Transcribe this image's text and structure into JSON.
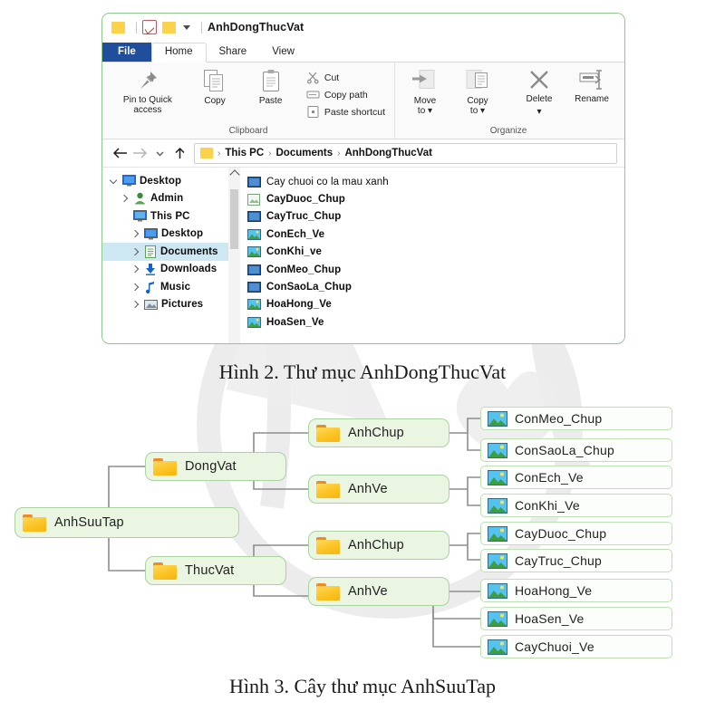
{
  "explorer": {
    "quick_access": {
      "title": "AnhDongThucVat",
      "icons": [
        "folder-icon",
        "properties-icon",
        "new-folder-icon",
        "customize-chevron-icon"
      ]
    },
    "tabs": [
      {
        "label": "File",
        "active": false,
        "kind": "file"
      },
      {
        "label": "Home",
        "active": true,
        "kind": "normal"
      },
      {
        "label": "Share",
        "active": false,
        "kind": "normal"
      },
      {
        "label": "View",
        "active": false,
        "kind": "normal"
      }
    ],
    "ribbon": {
      "groups": [
        {
          "name": "Clipboard",
          "label": "Clipboard",
          "big_buttons": [
            {
              "label": "Pin to Quick\naccess",
              "icon": "pin-icon"
            },
            {
              "label": "Copy",
              "icon": "copy-icon"
            },
            {
              "label": "Paste",
              "icon": "paste-icon"
            }
          ],
          "small_buttons": [
            {
              "label": "Cut",
              "icon": "scissors-icon"
            },
            {
              "label": "Copy path",
              "icon": "copy-path-icon"
            },
            {
              "label": "Paste shortcut",
              "icon": "paste-shortcut-icon"
            }
          ]
        },
        {
          "name": "Organize",
          "label": "Organize",
          "big_buttons": [
            {
              "label": "Move\nto",
              "icon": "move-to-icon"
            },
            {
              "label": "Copy\nto",
              "icon": "copy-to-icon"
            },
            {
              "label": "Delete",
              "icon": "delete-x-icon"
            },
            {
              "label": "Rename",
              "icon": "rename-icon"
            }
          ],
          "small_buttons": []
        }
      ]
    },
    "address_bar": {
      "back_icon": "back-arrow-icon",
      "forward_icon": "forward-arrow-icon",
      "recent_icon": "chevron-down-icon",
      "up_icon": "up-arrow-icon",
      "breadcrumbs": [
        "This PC",
        "Documents",
        "AnhDongThucVat"
      ],
      "separator": "›"
    },
    "nav_pane": {
      "items": [
        {
          "label": "Desktop",
          "indent": 0,
          "twisty": "down",
          "icon": "monitor-icon",
          "selected": false
        },
        {
          "label": "Admin",
          "indent": 1,
          "twisty": "right",
          "icon": "user-icon",
          "selected": false
        },
        {
          "label": "This PC",
          "indent": 1,
          "twisty": "none",
          "icon": "monitor-icon",
          "selected": false
        },
        {
          "label": "Desktop",
          "indent": 2,
          "twisty": "right",
          "icon": "monitor-icon",
          "selected": false
        },
        {
          "label": "Documents",
          "indent": 2,
          "twisty": "right",
          "icon": "documents-icon",
          "selected": true
        },
        {
          "label": "Downloads",
          "indent": 2,
          "twisty": "right",
          "icon": "download-icon",
          "selected": false
        },
        {
          "label": "Music",
          "indent": 2,
          "twisty": "right",
          "icon": "music-note-icon",
          "selected": false
        },
        {
          "label": "Pictures",
          "indent": 2,
          "twisty": "right",
          "icon": "pictures-icon",
          "selected": false
        }
      ]
    },
    "file_list": {
      "items": [
        {
          "label": "Cay chuoi co la mau xanh",
          "icon": "bmp-image-icon",
          "bold": false
        },
        {
          "label": "CayDuoc_Chup",
          "icon": "gif-image-icon",
          "bold": true
        },
        {
          "label": "CayTruc_Chup",
          "icon": "bmp-image-icon",
          "bold": true
        },
        {
          "label": "ConEch_Ve",
          "icon": "png-image-icon",
          "bold": true
        },
        {
          "label": "ConKhi_ve",
          "icon": "png-image-icon",
          "bold": true
        },
        {
          "label": "ConMeo_Chup",
          "icon": "bmp-image-icon",
          "bold": true
        },
        {
          "label": "ConSaoLa_Chup",
          "icon": "bmp-image-icon",
          "bold": true
        },
        {
          "label": "HoaHong_Ve",
          "icon": "png-image-icon",
          "bold": true
        },
        {
          "label": "HoaSen_Ve",
          "icon": "png-image-icon",
          "bold": true
        }
      ]
    }
  },
  "captions": {
    "figure2": "Hình 2. Thư mục AnhDongThucVat",
    "figure3": "Hình 3. Cây thư mục AnhSuuTap"
  },
  "tree": {
    "root": {
      "label": "AnhSuuTap",
      "icon": "folder-icon"
    },
    "nodes": [
      {
        "id": "root",
        "label": "AnhSuuTap",
        "icon": "folder-icon",
        "level": 0
      },
      {
        "id": "dongvat",
        "label": "DongVat",
        "icon": "folder-icon",
        "level": 1
      },
      {
        "id": "thucvat",
        "label": "ThucVat",
        "icon": "folder-icon",
        "level": 1
      },
      {
        "id": "dv-chup",
        "label": "AnhChup",
        "icon": "folder-icon",
        "level": 2
      },
      {
        "id": "dv-ve",
        "label": "AnhVe",
        "icon": "folder-icon",
        "level": 2
      },
      {
        "id": "tv-chup",
        "label": "AnhChup",
        "icon": "folder-icon",
        "level": 2
      },
      {
        "id": "tv-ve",
        "label": "AnhVe",
        "icon": "folder-icon",
        "level": 2
      }
    ],
    "leaves": [
      {
        "id": "l1",
        "label": "ConMeo_Chup",
        "icon": "image-icon",
        "parent": "dv-chup"
      },
      {
        "id": "l2",
        "label": "ConSaoLa_Chup",
        "icon": "image-icon",
        "parent": "dv-chup"
      },
      {
        "id": "l3",
        "label": "ConEch_Ve",
        "icon": "image-icon",
        "parent": "dv-ve"
      },
      {
        "id": "l4",
        "label": "ConKhi_Ve",
        "icon": "image-icon",
        "parent": "dv-ve"
      },
      {
        "id": "l5",
        "label": "CayDuoc_Chup",
        "icon": "image-icon",
        "parent": "tv-chup"
      },
      {
        "id": "l6",
        "label": "CayTruc_Chup",
        "icon": "image-icon",
        "parent": "tv-chup"
      },
      {
        "id": "l7",
        "label": "HoaHong_Ve",
        "icon": "image-icon",
        "parent": "tv-ve"
      },
      {
        "id": "l8",
        "label": "HoaSen_Ve",
        "icon": "image-icon",
        "parent": "tv-ve"
      },
      {
        "id": "l9",
        "label": "CayChuoi_Ve",
        "icon": "image-icon",
        "parent": "tv-ve"
      }
    ]
  },
  "colors": {
    "window_border": "#8cc68c",
    "file_tab": "#1e4e9c",
    "selection": "#cde8f2",
    "node_fill": "#eaf5e2",
    "node_border": "#a9d3a1",
    "folder_yellow": "#fcc324",
    "connector": "#8d8d8d"
  }
}
